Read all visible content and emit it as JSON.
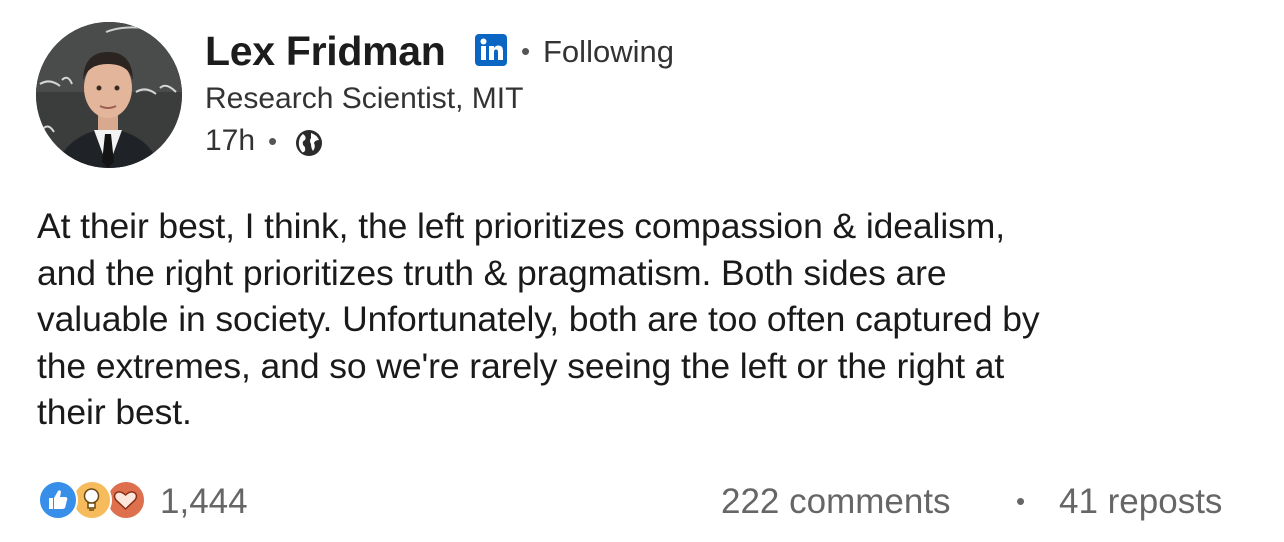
{
  "author": {
    "name": "Lex Fridman",
    "follow_status": "Following",
    "headline": "Research Scientist, MIT",
    "time_ago": "17h",
    "separator": "•"
  },
  "icons": {
    "avatar": "profile-photo",
    "badge": "linkedin-icon",
    "visibility": "globe-icon",
    "reactions": [
      "like-icon",
      "insightful-icon",
      "love-icon"
    ]
  },
  "post": {
    "lines": [
      "At their best, I think, the left prioritizes compassion & idealism,",
      "and the right prioritizes truth & pragmatism. Both sides are",
      "valuable in society. Unfortunately, both are too often captured by",
      "the extremes, and so we're rarely seeing the left or the right at",
      "their best."
    ]
  },
  "stats": {
    "reaction_count": "1,444",
    "comments": "222 comments",
    "reposts": "41 reposts",
    "separator": "•"
  },
  "colors": {
    "linkedin_blue": "#0a66c2",
    "like_blue": "#378fe9",
    "insightful_yellow": "#f5bb5c",
    "love_red": "#df704d",
    "text_primary": "#1a1a1a",
    "text_secondary": "#666666"
  }
}
